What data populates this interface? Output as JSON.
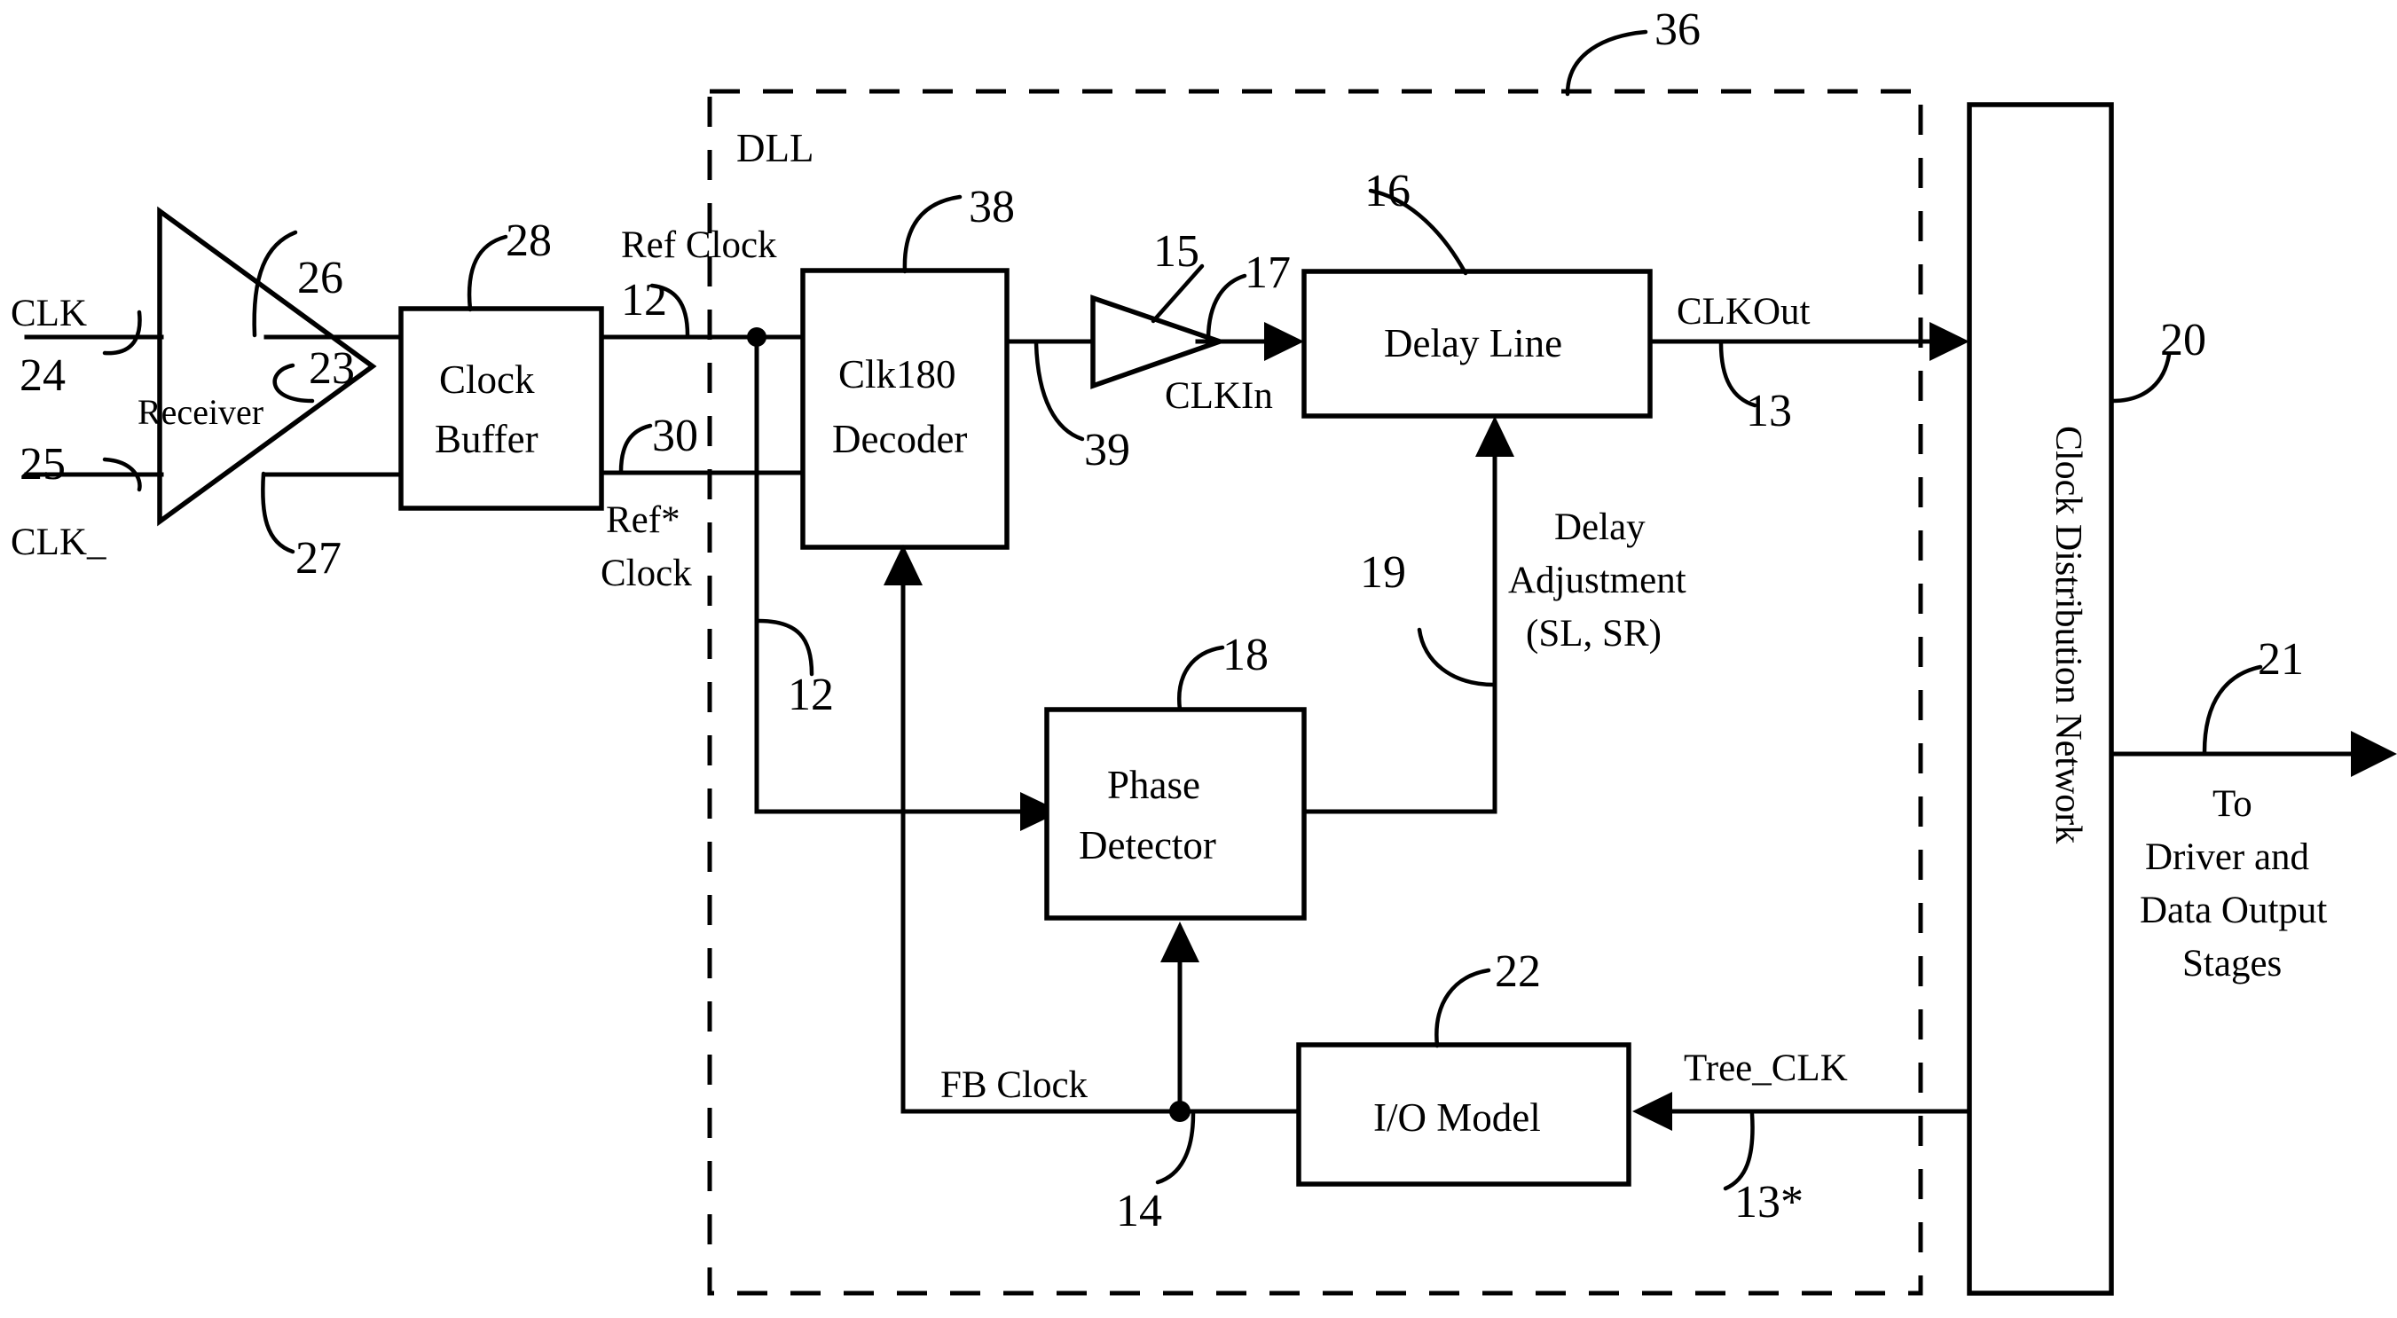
{
  "figure": {
    "type": "patent-block-diagram",
    "title_label": "DLL",
    "background": "#ffffff",
    "line_color": "#000000"
  },
  "blocks": {
    "receiver": {
      "label": "Receiver",
      "ref": "26"
    },
    "clock_buffer": {
      "label_line1": "Clock",
      "label_line2": "Buffer",
      "ref": "28"
    },
    "clk180_decoder": {
      "label_line1": "Clk180",
      "label_line2": "Decoder",
      "ref": "38"
    },
    "buffer_amp": {
      "ref": "15"
    },
    "delay_line": {
      "label": "Delay Line",
      "ref": "16"
    },
    "phase_detector": {
      "label_line1": "Phase",
      "label_line2": "Detector",
      "ref": "18"
    },
    "io_model": {
      "label": "I/O Model",
      "ref": "22"
    },
    "clock_distribution_network": {
      "label": "Clock Distribution Network",
      "ref": "20"
    },
    "dll_boundary": {
      "label": "DLL",
      "ref": "36"
    }
  },
  "signals": {
    "clk": "CLK",
    "clk_bar": "CLK_",
    "ref_clock_line1": "Ref Clock",
    "ref_clock_line2": "Ref*",
    "ref_clock_line3": "Clock",
    "clkin": "CLKIn",
    "clkout": "CLKOut",
    "fb_clock": "FB Clock",
    "tree_clk": "Tree_CLK",
    "delay_adjustment_line1": "Delay",
    "delay_adjustment_line2": "Adjustment",
    "delay_adjustment_line3": "(SL, SR)",
    "to_driver_line1": "To",
    "to_driver_line2": "Driver and",
    "to_driver_line3": "Data Output",
    "to_driver_line4": "Stages"
  },
  "reference_numerals": {
    "n12_top": "12",
    "n12_mid": "12",
    "n13": "13",
    "n13star": "13*",
    "n14": "14",
    "n15": "15",
    "n16": "16",
    "n17": "17",
    "n18": "18",
    "n19": "19",
    "n20": "20",
    "n21": "21",
    "n22": "22",
    "n23": "23",
    "n24": "24",
    "n25": "25",
    "n26": "26",
    "n27": "27",
    "n28": "28",
    "n30": "30",
    "n36": "36",
    "n38": "38",
    "n39": "39"
  }
}
